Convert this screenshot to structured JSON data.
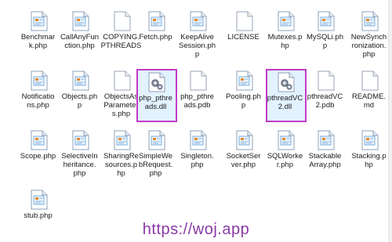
{
  "files": [
    {
      "name": "Benchmark.php",
      "label": "Benchmar\nk.php",
      "type": "php"
    },
    {
      "name": "CallAnyFunction.php",
      "label": "CallAnyFun\nction.php",
      "type": "php"
    },
    {
      "name": "COPYING.PTHREADS",
      "label": "COPYING.\nPTHREADS",
      "type": "blank"
    },
    {
      "name": "Fetch.php",
      "label": "Fetch.php",
      "type": "php"
    },
    {
      "name": "KeepAliveSession.php",
      "label": "KeepAlive\nSession.ph\np",
      "type": "php"
    },
    {
      "name": "LICENSE",
      "label": "LICENSE",
      "type": "blank"
    },
    {
      "name": "Mutexes.php",
      "label": "Mutexes.p\nhp",
      "type": "php"
    },
    {
      "name": "MySQLi.php",
      "label": "MySQLi.ph\np",
      "type": "php"
    },
    {
      "name": "NewSynchronization.php",
      "label": "NewSynch\nronization.\nphp",
      "type": "php"
    },
    {
      "name": "Notifications.php",
      "label": "Notificatio\nns.php",
      "type": "php"
    },
    {
      "name": "Objects.php",
      "label": "Objects.ph\np",
      "type": "php"
    },
    {
      "name": "ObjectsAsParameters.php",
      "label": "ObjectsAs\nParameter\ns.php",
      "type": "blank"
    },
    {
      "name": "php_pthreads.dll",
      "label": "php_pthre\nads.dll",
      "type": "dll",
      "selected": true
    },
    {
      "name": "php_pthreads.pdb",
      "label": "php_pthre\nads.pdb",
      "type": "blank"
    },
    {
      "name": "Pooling.php",
      "label": "Pooling.ph\np",
      "type": "php"
    },
    {
      "name": "pthreadVC2.dll",
      "label": "pthreadVC\n2.dll",
      "type": "dll",
      "selected": true
    },
    {
      "name": "pthreadVC2.pdb",
      "label": "pthreadVC\n2.pdb",
      "type": "blank"
    },
    {
      "name": "README.md",
      "label": "README.\nmd",
      "type": "blank"
    },
    {
      "name": "Scope.php",
      "label": "Scope.php",
      "type": "php"
    },
    {
      "name": "SelectiveInheritance.php",
      "label": "SelectiveIn\nheritance.\nphp",
      "type": "php"
    },
    {
      "name": "SharingResources.php",
      "label": "SharingRe\nsources.p\nhp",
      "type": "php"
    },
    {
      "name": "SimpleWebRequest.php",
      "label": "SimpleWe\nbRequest.\nphp",
      "type": "php"
    },
    {
      "name": "Singleton.php",
      "label": "Singleton.\nphp",
      "type": "php"
    },
    {
      "name": "SocketServer.php",
      "label": "SocketSer\nver.php",
      "type": "php"
    },
    {
      "name": "SQLWorker.php",
      "label": "SQLWorke\nr.php",
      "type": "php"
    },
    {
      "name": "StackableArray.php",
      "label": "Stackable\nArray.php",
      "type": "php"
    },
    {
      "name": "Stacking.php",
      "label": "Stacking.p\nhp",
      "type": "php"
    },
    {
      "name": "stub.php",
      "label": "stub.php",
      "type": "php"
    }
  ],
  "icons": {
    "php": "php-file-icon",
    "blank": "blank-file-icon",
    "dll": "dll-gear-file-icon"
  },
  "colors": {
    "selection_border": "#c13bc7",
    "watermark": "#8a3aa5"
  },
  "watermark": "https://woj.app"
}
